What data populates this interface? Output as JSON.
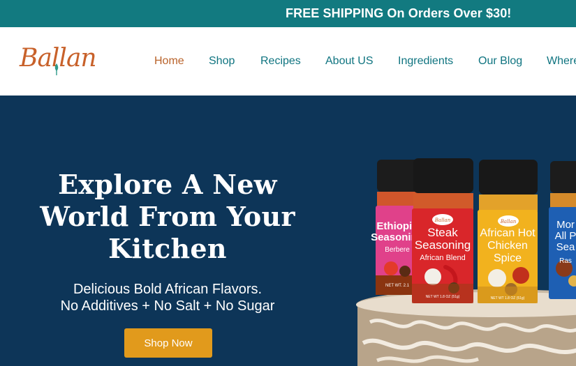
{
  "announcement": {
    "text": "FREE SHIPPING On Orders Over $30!"
  },
  "header": {
    "logo_text": "Ballan",
    "nav": [
      {
        "label": "Home",
        "active": true
      },
      {
        "label": "Shop",
        "active": false
      },
      {
        "label": "Recipes",
        "active": false
      },
      {
        "label": "About US",
        "active": false
      },
      {
        "label": "Ingredients",
        "active": false
      },
      {
        "label": "Our Blog",
        "active": false
      },
      {
        "label": "Where",
        "active": false
      }
    ]
  },
  "hero": {
    "title_lines": [
      "Explore A New",
      "World From Your",
      "Kitchen"
    ],
    "subtitle_lines": [
      "Delicious Bold African Flavors.",
      "No Additives + No Salt + No Sugar"
    ],
    "cta_label": "Shop Now"
  },
  "products": [
    {
      "brand": "Ballan",
      "name_lines": [
        "Ethiopia",
        "Seasoning"
      ],
      "tagline": "Berbere",
      "net_wt": "NET WT. 2.1"
    },
    {
      "brand": "Ballan",
      "name_lines": [
        "Steak",
        "Seasoning"
      ],
      "tagline": "African Blend",
      "net_wt": "NET WT 1.8 OZ (51g)"
    },
    {
      "brand": "Ballan",
      "name_lines": [
        "African Hot",
        "Chicken",
        "Spice"
      ],
      "tagline": "",
      "net_wt": "NET WT 1.8 OZ (51g)"
    },
    {
      "brand": "",
      "name_lines": [
        "Mor",
        "All P",
        "Sea"
      ],
      "tagline": "Ras",
      "net_wt": ""
    }
  ],
  "colors": {
    "topbar": "#127a80",
    "nav_text": "#0f7480",
    "nav_active": "#b9622a",
    "hero_bg": "#0d3558",
    "cta": "#e19a1c"
  }
}
